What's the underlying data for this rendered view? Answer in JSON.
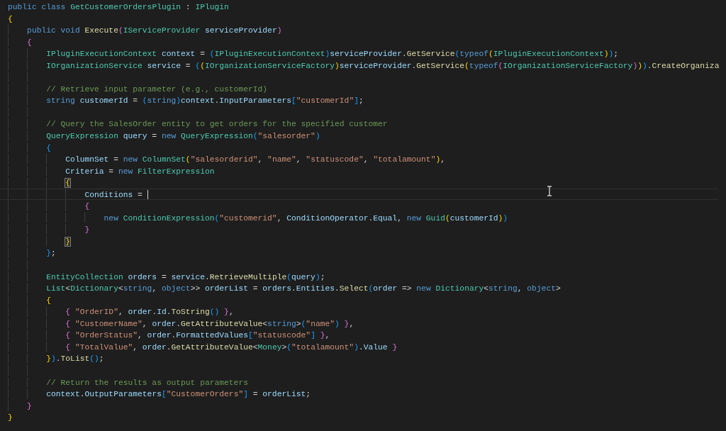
{
  "editor": {
    "lines": [
      {
        "current": false,
        "tokens": [
          {
            "text": "public class ",
            "kind": "kw"
          },
          {
            "text": "GetCustomerOrdersPlugin",
            "kind": "type"
          },
          {
            "text": " : ",
            "kind": "plain"
          },
          {
            "text": "IPlugin",
            "kind": "type"
          }
        ]
      },
      {
        "current": false,
        "tokens": [
          {
            "text": "{",
            "kind": "b1"
          }
        ],
        "children": [
          {
            "current": false,
            "tokens": [
              {
                "text": "public void ",
                "kind": "kw"
              },
              {
                "text": "Execute",
                "kind": "fn"
              },
              {
                "text": "(",
                "kind": "b2"
              },
              {
                "text": "IServiceProvider ",
                "kind": "type"
              },
              {
                "text": "serviceProvider",
                "kind": "var"
              },
              {
                "text": ")",
                "kind": "b2"
              }
            ]
          },
          {
            "current": false,
            "tokens": [
              {
                "text": "{",
                "kind": "b2"
              }
            ],
            "children": [
              {
                "current": false,
                "tokens": [
                  {
                    "text": "IPluginExecutionContext ",
                    "kind": "type"
                  },
                  {
                    "text": "context",
                    "kind": "var"
                  },
                  {
                    "text": " = ",
                    "kind": "plain"
                  },
                  {
                    "text": "(",
                    "kind": "b3"
                  },
                  {
                    "text": "IPluginExecutionContext",
                    "kind": "type"
                  },
                  {
                    "text": ")",
                    "kind": "b3"
                  },
                  {
                    "text": "serviceProvider",
                    "kind": "var"
                  },
                  {
                    "text": ".",
                    "kind": "plain"
                  },
                  {
                    "text": "GetService",
                    "kind": "fn"
                  },
                  {
                    "text": "(",
                    "kind": "b3"
                  },
                  {
                    "text": "typeof",
                    "kind": "kw"
                  },
                  {
                    "text": "(",
                    "kind": "b1"
                  },
                  {
                    "text": "IPluginExecutionContext",
                    "kind": "type"
                  },
                  {
                    "text": ")",
                    "kind": "b1"
                  },
                  {
                    "text": ")",
                    "kind": "b3"
                  },
                  {
                    "text": ";",
                    "kind": "plain"
                  }
                ]
              },
              {
                "current": false,
                "tokens": [
                  {
                    "text": "IOrganizationService ",
                    "kind": "type"
                  },
                  {
                    "text": "service",
                    "kind": "var"
                  },
                  {
                    "text": " = ",
                    "kind": "plain"
                  },
                  {
                    "text": "(",
                    "kind": "b3"
                  },
                  {
                    "text": "(",
                    "kind": "b1"
                  },
                  {
                    "text": "IOrganizationServiceFactory",
                    "kind": "type"
                  },
                  {
                    "text": ")",
                    "kind": "b1"
                  },
                  {
                    "text": "serviceProvider",
                    "kind": "var"
                  },
                  {
                    "text": ".",
                    "kind": "plain"
                  },
                  {
                    "text": "GetService",
                    "kind": "fn"
                  },
                  {
                    "text": "(",
                    "kind": "b1"
                  },
                  {
                    "text": "typeof",
                    "kind": "kw"
                  },
                  {
                    "text": "(",
                    "kind": "b2"
                  },
                  {
                    "text": "IOrganizationServiceFactory",
                    "kind": "type"
                  },
                  {
                    "text": ")",
                    "kind": "b2"
                  },
                  {
                    "text": ")",
                    "kind": "b1"
                  },
                  {
                    "text": ")",
                    "kind": "b3"
                  },
                  {
                    "text": ".",
                    "kind": "plain"
                  },
                  {
                    "text": "CreateOrganiza",
                    "kind": "fn"
                  }
                ]
              },
              {
                "current": false
              },
              {
                "current": false,
                "tokens": [
                  {
                    "text": "// Retrieve input parameter (e.g., customerId)",
                    "kind": "cmt"
                  }
                ]
              },
              {
                "current": false,
                "tokens": [
                  {
                    "text": "string ",
                    "kind": "kw"
                  },
                  {
                    "text": "customerId",
                    "kind": "var"
                  },
                  {
                    "text": " = ",
                    "kind": "plain"
                  },
                  {
                    "text": "(",
                    "kind": "b3"
                  },
                  {
                    "text": "string",
                    "kind": "kw"
                  },
                  {
                    "text": ")",
                    "kind": "b3"
                  },
                  {
                    "text": "context",
                    "kind": "var"
                  },
                  {
                    "text": ".",
                    "kind": "plain"
                  },
                  {
                    "text": "InputParameters",
                    "kind": "var"
                  },
                  {
                    "text": "[",
                    "kind": "b3"
                  },
                  {
                    "text": "\"customerId\"",
                    "kind": "str"
                  },
                  {
                    "text": "]",
                    "kind": "b3"
                  },
                  {
                    "text": ";",
                    "kind": "plain"
                  }
                ]
              },
              {
                "current": false
              },
              {
                "current": false,
                "tokens": [
                  {
                    "text": "// Query the SalesOrder entity to get orders for the specified customer",
                    "kind": "cmt"
                  }
                ]
              },
              {
                "current": false,
                "tokens": [
                  {
                    "text": "QueryExpression ",
                    "kind": "type"
                  },
                  {
                    "text": "query",
                    "kind": "var"
                  },
                  {
                    "text": " = ",
                    "kind": "plain"
                  },
                  {
                    "text": "new ",
                    "kind": "kw"
                  },
                  {
                    "text": "QueryExpression",
                    "kind": "type"
                  },
                  {
                    "text": "(",
                    "kind": "b3"
                  },
                  {
                    "text": "\"salesorder\"",
                    "kind": "str"
                  },
                  {
                    "text": ")",
                    "kind": "b3"
                  }
                ]
              },
              {
                "current": false,
                "tokens": [
                  {
                    "text": "{",
                    "kind": "b3"
                  }
                ],
                "children": [
                  {
                    "current": false,
                    "tokens": [
                      {
                        "text": "ColumnSet",
                        "kind": "var"
                      },
                      {
                        "text": " = ",
                        "kind": "plain"
                      },
                      {
                        "text": "new ",
                        "kind": "kw"
                      },
                      {
                        "text": "ColumnSet",
                        "kind": "type"
                      },
                      {
                        "text": "(",
                        "kind": "b1"
                      },
                      {
                        "text": "\"salesorderid\"",
                        "kind": "str"
                      },
                      {
                        "text": ", ",
                        "kind": "plain"
                      },
                      {
                        "text": "\"name\"",
                        "kind": "str"
                      },
                      {
                        "text": ", ",
                        "kind": "plain"
                      },
                      {
                        "text": "\"statuscode\"",
                        "kind": "str"
                      },
                      {
                        "text": ", ",
                        "kind": "plain"
                      },
                      {
                        "text": "\"totalamount\"",
                        "kind": "str"
                      },
                      {
                        "text": ")",
                        "kind": "b1"
                      },
                      {
                        "text": ",",
                        "kind": "plain"
                      }
                    ]
                  },
                  {
                    "current": false,
                    "tokens": [
                      {
                        "text": "Criteria",
                        "kind": "var"
                      },
                      {
                        "text": " = ",
                        "kind": "plain"
                      },
                      {
                        "text": "new ",
                        "kind": "kw"
                      },
                      {
                        "text": "FilterExpression",
                        "kind": "type"
                      }
                    ]
                  },
                  {
                    "current": false,
                    "tokens": [
                      {
                        "text": "{",
                        "kind": "match"
                      }
                    ],
                    "children": [
                      {
                        "current": true,
                        "tokens": [
                          {
                            "text": "Conditions",
                            "kind": "var"
                          },
                          {
                            "text": " = ",
                            "kind": "plain"
                          }
                        ]
                      },
                      {
                        "current": false,
                        "tokens": [
                          {
                            "text": "{",
                            "kind": "b2"
                          }
                        ],
                        "children": [
                          {
                            "current": false,
                            "tokens": [
                              {
                                "text": "new ",
                                "kind": "kw"
                              },
                              {
                                "text": "ConditionExpression",
                                "kind": "type"
                              },
                              {
                                "text": "(",
                                "kind": "b3"
                              },
                              {
                                "text": "\"customerid\"",
                                "kind": "str"
                              },
                              {
                                "text": ", ",
                                "kind": "plain"
                              },
                              {
                                "text": "ConditionOperator",
                                "kind": "var"
                              },
                              {
                                "text": ".",
                                "kind": "plain"
                              },
                              {
                                "text": "Equal",
                                "kind": "var"
                              },
                              {
                                "text": ", ",
                                "kind": "plain"
                              },
                              {
                                "text": "new ",
                                "kind": "kw"
                              },
                              {
                                "text": "Guid",
                                "kind": "type"
                              },
                              {
                                "text": "(",
                                "kind": "b1"
                              },
                              {
                                "text": "customerId",
                                "kind": "var"
                              },
                              {
                                "text": ")",
                                "kind": "b1"
                              },
                              {
                                "text": ")",
                                "kind": "b3"
                              }
                            ]
                          }
                        ]
                      },
                      {
                        "current": false,
                        "tokens": [
                          {
                            "text": "}",
                            "kind": "b2"
                          }
                        ]
                      }
                    ]
                  },
                  {
                    "current": false,
                    "tokens": [
                      {
                        "text": "}",
                        "kind": "match"
                      }
                    ]
                  }
                ]
              },
              {
                "current": false,
                "tokens": [
                  {
                    "text": "}",
                    "kind": "b3"
                  },
                  {
                    "text": ";",
                    "kind": "plain"
                  }
                ]
              },
              {
                "current": false
              },
              {
                "current": false,
                "tokens": [
                  {
                    "text": "EntityCollection ",
                    "kind": "type"
                  },
                  {
                    "text": "orders",
                    "kind": "var"
                  },
                  {
                    "text": " = ",
                    "kind": "plain"
                  },
                  {
                    "text": "service",
                    "kind": "var"
                  },
                  {
                    "text": ".",
                    "kind": "plain"
                  },
                  {
                    "text": "RetrieveMultiple",
                    "kind": "fn"
                  },
                  {
                    "text": "(",
                    "kind": "b3"
                  },
                  {
                    "text": "query",
                    "kind": "var"
                  },
                  {
                    "text": ")",
                    "kind": "b3"
                  },
                  {
                    "text": ";",
                    "kind": "plain"
                  }
                ]
              },
              {
                "current": false,
                "tokens": [
                  {
                    "text": "List",
                    "kind": "type"
                  },
                  {
                    "text": "<",
                    "kind": "plain"
                  },
                  {
                    "text": "Dictionary",
                    "kind": "type"
                  },
                  {
                    "text": "<",
                    "kind": "plain"
                  },
                  {
                    "text": "string",
                    "kind": "kw"
                  },
                  {
                    "text": ", ",
                    "kind": "plain"
                  },
                  {
                    "text": "object",
                    "kind": "kw"
                  },
                  {
                    "text": ">> ",
                    "kind": "plain"
                  },
                  {
                    "text": "orderList",
                    "kind": "var"
                  },
                  {
                    "text": " = ",
                    "kind": "plain"
                  },
                  {
                    "text": "orders",
                    "kind": "var"
                  },
                  {
                    "text": ".",
                    "kind": "plain"
                  },
                  {
                    "text": "Entities",
                    "kind": "var"
                  },
                  {
                    "text": ".",
                    "kind": "plain"
                  },
                  {
                    "text": "Select",
                    "kind": "fn"
                  },
                  {
                    "text": "(",
                    "kind": "b3"
                  },
                  {
                    "text": "order",
                    "kind": "var"
                  },
                  {
                    "text": " => ",
                    "kind": "plain"
                  },
                  {
                    "text": "new ",
                    "kind": "kw"
                  },
                  {
                    "text": "Dictionary",
                    "kind": "type"
                  },
                  {
                    "text": "<",
                    "kind": "plain"
                  },
                  {
                    "text": "string",
                    "kind": "kw"
                  },
                  {
                    "text": ", ",
                    "kind": "plain"
                  },
                  {
                    "text": "object",
                    "kind": "kw"
                  },
                  {
                    "text": ">",
                    "kind": "plain"
                  }
                ]
              },
              {
                "current": false,
                "tokens": [
                  {
                    "text": "{",
                    "kind": "b1"
                  }
                ],
                "children": [
                  {
                    "current": false,
                    "tokens": [
                      {
                        "text": "{ ",
                        "kind": "b2"
                      },
                      {
                        "text": "\"OrderID\"",
                        "kind": "str"
                      },
                      {
                        "text": ", ",
                        "kind": "plain"
                      },
                      {
                        "text": "order",
                        "kind": "var"
                      },
                      {
                        "text": ".",
                        "kind": "plain"
                      },
                      {
                        "text": "Id",
                        "kind": "var"
                      },
                      {
                        "text": ".",
                        "kind": "plain"
                      },
                      {
                        "text": "ToString",
                        "kind": "fn"
                      },
                      {
                        "text": "() ",
                        "kind": "b3"
                      },
                      {
                        "text": "}",
                        "kind": "b2"
                      },
                      {
                        "text": ",",
                        "kind": "plain"
                      }
                    ]
                  },
                  {
                    "current": false,
                    "tokens": [
                      {
                        "text": "{ ",
                        "kind": "b2"
                      },
                      {
                        "text": "\"CustomerName\"",
                        "kind": "str"
                      },
                      {
                        "text": ", ",
                        "kind": "plain"
                      },
                      {
                        "text": "order",
                        "kind": "var"
                      },
                      {
                        "text": ".",
                        "kind": "plain"
                      },
                      {
                        "text": "GetAttributeValue",
                        "kind": "fn"
                      },
                      {
                        "text": "<",
                        "kind": "plain"
                      },
                      {
                        "text": "string",
                        "kind": "kw"
                      },
                      {
                        "text": ">",
                        "kind": "plain"
                      },
                      {
                        "text": "(",
                        "kind": "b3"
                      },
                      {
                        "text": "\"name\"",
                        "kind": "str"
                      },
                      {
                        "text": ") ",
                        "kind": "b3"
                      },
                      {
                        "text": "}",
                        "kind": "b2"
                      },
                      {
                        "text": ",",
                        "kind": "plain"
                      }
                    ]
                  },
                  {
                    "current": false,
                    "tokens": [
                      {
                        "text": "{ ",
                        "kind": "b2"
                      },
                      {
                        "text": "\"OrderStatus\"",
                        "kind": "str"
                      },
                      {
                        "text": ", ",
                        "kind": "plain"
                      },
                      {
                        "text": "order",
                        "kind": "var"
                      },
                      {
                        "text": ".",
                        "kind": "plain"
                      },
                      {
                        "text": "FormattedValues",
                        "kind": "var"
                      },
                      {
                        "text": "[",
                        "kind": "b3"
                      },
                      {
                        "text": "\"statuscode\"",
                        "kind": "str"
                      },
                      {
                        "text": "] ",
                        "kind": "b3"
                      },
                      {
                        "text": "}",
                        "kind": "b2"
                      },
                      {
                        "text": ",",
                        "kind": "plain"
                      }
                    ]
                  },
                  {
                    "current": false,
                    "tokens": [
                      {
                        "text": "{ ",
                        "kind": "b2"
                      },
                      {
                        "text": "\"TotalValue\"",
                        "kind": "str"
                      },
                      {
                        "text": ", ",
                        "kind": "plain"
                      },
                      {
                        "text": "order",
                        "kind": "var"
                      },
                      {
                        "text": ".",
                        "kind": "plain"
                      },
                      {
                        "text": "GetAttributeValue",
                        "kind": "fn"
                      },
                      {
                        "text": "<",
                        "kind": "plain"
                      },
                      {
                        "text": "Money",
                        "kind": "type"
                      },
                      {
                        "text": ">",
                        "kind": "plain"
                      },
                      {
                        "text": "(",
                        "kind": "b3"
                      },
                      {
                        "text": "\"totalamount\"",
                        "kind": "str"
                      },
                      {
                        "text": ")",
                        "kind": "b3"
                      },
                      {
                        "text": ".",
                        "kind": "plain"
                      },
                      {
                        "text": "Value ",
                        "kind": "var"
                      },
                      {
                        "text": "}",
                        "kind": "b2"
                      }
                    ]
                  }
                ]
              },
              {
                "current": false,
                "tokens": [
                  {
                    "text": "}",
                    "kind": "b1"
                  },
                  {
                    "text": ")",
                    "kind": "b3"
                  },
                  {
                    "text": ".",
                    "kind": "plain"
                  },
                  {
                    "text": "ToList",
                    "kind": "fn"
                  },
                  {
                    "text": "()",
                    "kind": "b3"
                  },
                  {
                    "text": ";",
                    "kind": "plain"
                  }
                ]
              },
              {
                "current": false
              },
              {
                "current": false,
                "tokens": [
                  {
                    "text": "// Return the results as output parameters",
                    "kind": "cmt"
                  }
                ]
              },
              {
                "current": false,
                "tokens": [
                  {
                    "text": "context",
                    "kind": "var"
                  },
                  {
                    "text": ".",
                    "kind": "plain"
                  },
                  {
                    "text": "OutputParameters",
                    "kind": "var"
                  },
                  {
                    "text": "[",
                    "kind": "b3"
                  },
                  {
                    "text": "\"CustomerOrders\"",
                    "kind": "str"
                  },
                  {
                    "text": "]",
                    "kind": "b3"
                  },
                  {
                    "text": " = ",
                    "kind": "plain"
                  },
                  {
                    "text": "orderList",
                    "kind": "var"
                  },
                  {
                    "text": ";",
                    "kind": "plain"
                  }
                ]
              }
            ]
          },
          {
            "current": false,
            "tokens": [
              {
                "text": "}",
                "kind": "b2"
              }
            ]
          }
        ]
      },
      {
        "current": false,
        "tokens": [
          {
            "text": "}",
            "kind": "b1"
          }
        ]
      }
    ]
  }
}
